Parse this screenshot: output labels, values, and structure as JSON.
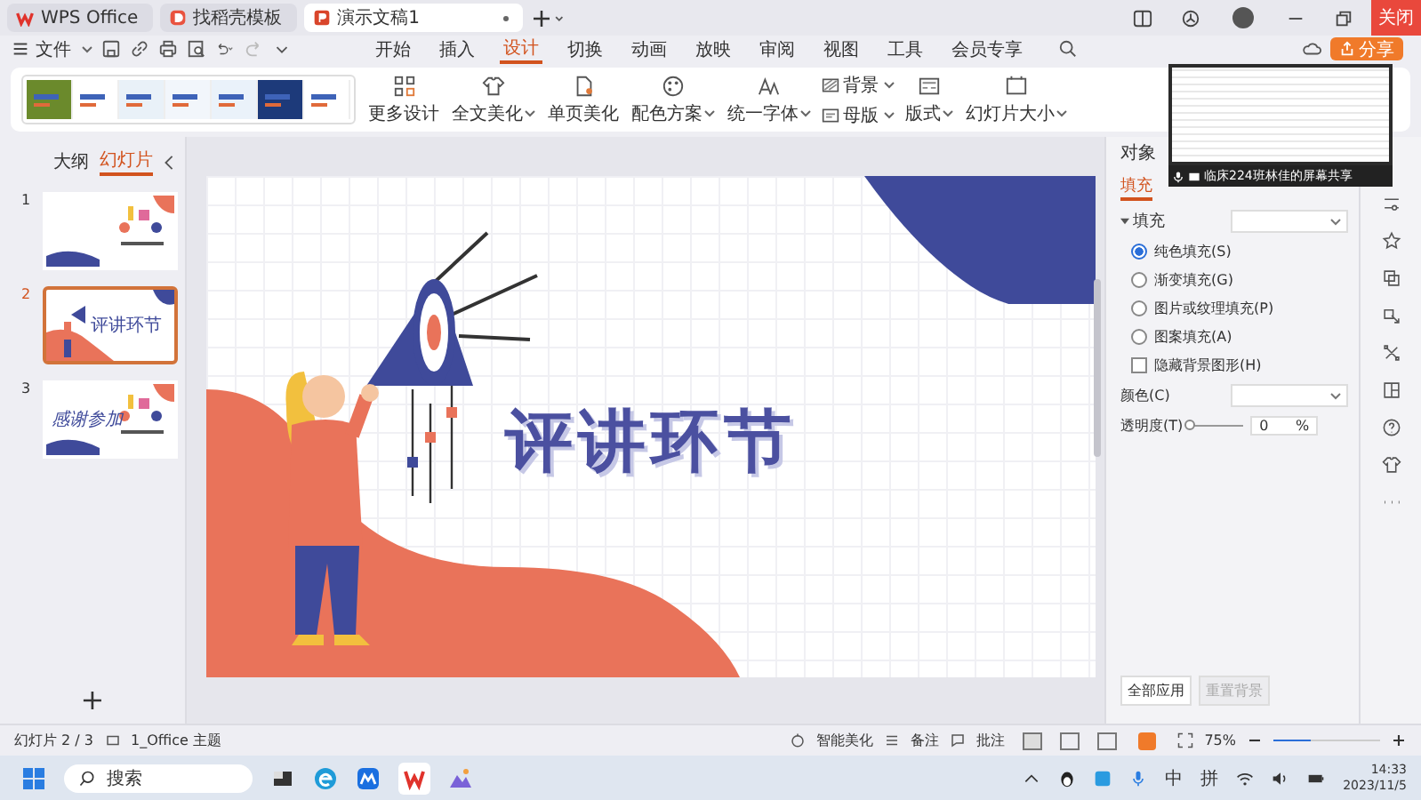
{
  "tabs": [
    {
      "label": "WPS Office",
      "kind": "home",
      "selected": false
    },
    {
      "label": "找稻壳模板",
      "kind": "docer",
      "selected": false
    },
    {
      "label": "演示文稿1",
      "kind": "doc",
      "selected": true
    }
  ],
  "window": {
    "close_label": "关闭"
  },
  "menu": {
    "file": "文件",
    "tabs": [
      {
        "label": "开始",
        "selected": false
      },
      {
        "label": "插入",
        "selected": false
      },
      {
        "label": "设计",
        "selected": true
      },
      {
        "label": "切换",
        "selected": false
      },
      {
        "label": "动画",
        "selected": false
      },
      {
        "label": "放映",
        "selected": false
      },
      {
        "label": "审阅",
        "selected": false
      },
      {
        "label": "视图",
        "selected": false
      },
      {
        "label": "工具",
        "selected": false
      },
      {
        "label": "会员专享",
        "selected": false
      }
    ],
    "share": "分享"
  },
  "ribbon": {
    "tools": [
      {
        "label": "更多设计",
        "dropdown": false
      },
      {
        "label": "全文美化",
        "dropdown": true
      },
      {
        "label": "单页美化",
        "dropdown": false
      },
      {
        "label": "配色方案",
        "dropdown": true
      },
      {
        "label": "统一字体",
        "dropdown": true
      }
    ],
    "small_tools": [
      {
        "label": "背景",
        "dropdown": true
      },
      {
        "label": "母版",
        "dropdown": true
      }
    ],
    "layout_tools": [
      {
        "label": "版式",
        "dropdown": true
      },
      {
        "label": "幻灯片大小",
        "dropdown": true
      }
    ]
  },
  "screen_share": {
    "caption": "临床224班林佳的屏幕共享"
  },
  "left_panel": {
    "tabs": [
      {
        "label": "大纲",
        "selected": false
      },
      {
        "label": "幻灯片",
        "selected": true
      }
    ],
    "slides": [
      {
        "number": "1",
        "kind": "people",
        "selected": false
      },
      {
        "number": "2",
        "kind": "megaphone",
        "title": "评讲环节",
        "selected": true
      },
      {
        "number": "3",
        "kind": "people",
        "title": "感谢参加",
        "selected": false
      }
    ],
    "add": "+"
  },
  "slide": {
    "title": "评讲环节"
  },
  "properties": {
    "header": "对象",
    "tab": "填充",
    "section": "填充",
    "fill_options": [
      {
        "label": "纯色填充(S)",
        "selected": true
      },
      {
        "label": "渐变填充(G)",
        "selected": false
      },
      {
        "label": "图片或纹理填充(P)",
        "selected": false
      },
      {
        "label": "图案填充(A)",
        "selected": false
      }
    ],
    "hide_background": {
      "label": "隐藏背景图形(H)",
      "checked": false
    },
    "color_label": "颜色(C)",
    "transparency": {
      "label": "透明度(T)",
      "level": 0,
      "value": "0",
      "unit": "%"
    },
    "apply_all": "全部应用",
    "reset": {
      "label": "重置背景",
      "disabled": true
    }
  },
  "status_bar": {
    "slide_count": "幻灯片 2 / 3",
    "theme": "1_Office 主题",
    "beautify": "智能美化",
    "notes": "备注",
    "comments": "批注",
    "zoom": "75%",
    "zoom_slider": {
      "level": 0.35
    }
  },
  "taskbar": {
    "search": "搜索",
    "ime_mode": "中",
    "ime": "拼",
    "time": "14:33",
    "date": "2023/11/5"
  }
}
